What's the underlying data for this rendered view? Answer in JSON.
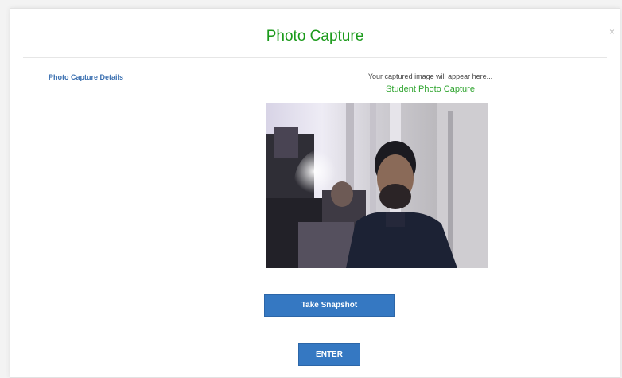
{
  "modal": {
    "title": "Photo Capture",
    "close_label": "×",
    "details_link": "Photo Capture Details",
    "hint_text": "Your captured image will appear here...",
    "subtitle": "Student Photo Capture"
  },
  "camera": {
    "icon": "webcam-feed"
  },
  "buttons": {
    "snapshot_label": "Take Snapshot",
    "enter_label": "ENTER"
  },
  "colors": {
    "title_green": "#1a9a1a",
    "subtitle_green": "#2ea42e",
    "link_blue": "#3a6fb0",
    "button_blue": "#3578c2"
  }
}
